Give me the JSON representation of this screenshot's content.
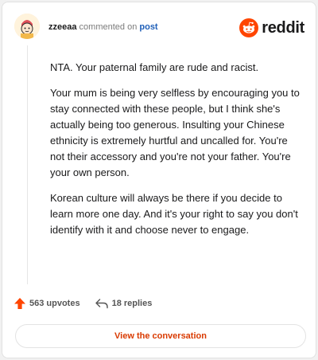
{
  "header": {
    "username": "zzeeaa",
    "action_text": "commented on",
    "post_link": "post",
    "brand_name": "reddit"
  },
  "comment": {
    "paragraphs": [
      "NTA. Your paternal family are rude and racist.",
      "Your mum is being very selfless by encouraging you to stay connected with these people, but I think she's actually being too generous. Insulting your Chinese ethnicity is extremely hurtful and uncalled for. You're not their accessory and you're not your father. You're your own person.",
      "Korean culture will always be there if you decide to learn more one day. And it's your right to say you don't identify with it and choose never to engage."
    ]
  },
  "actions": {
    "upvotes": "563 upvotes",
    "replies": "18 replies"
  },
  "cta": {
    "label": "View the conversation"
  },
  "icons": {
    "avatar": "avatar-icon",
    "brand": "reddit-snoo-icon",
    "upvote": "upvote-arrow-icon",
    "reply": "reply-arrow-icon"
  },
  "colors": {
    "accent": "#d93a00",
    "upvote": "#ff4500",
    "brand": "#ff4500",
    "link": "#1f5fb8"
  }
}
